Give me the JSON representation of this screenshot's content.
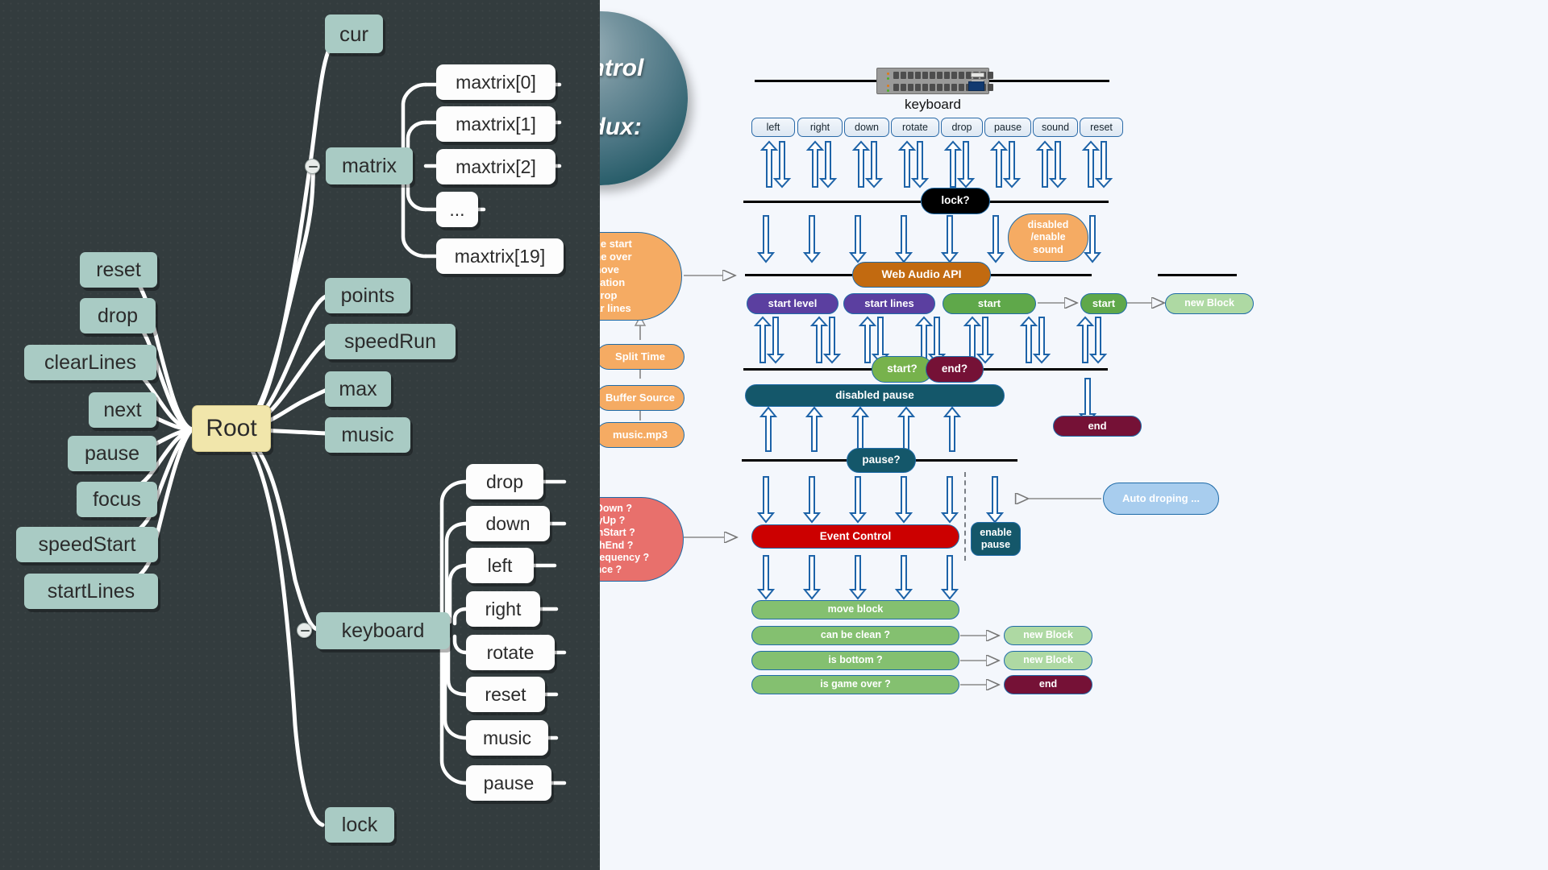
{
  "mindmap": {
    "root": {
      "label": "Root"
    },
    "nodes_left": [
      {
        "label": "reset"
      },
      {
        "label": "drop"
      },
      {
        "label": "clearLines"
      },
      {
        "label": "next"
      },
      {
        "label": "pause"
      },
      {
        "label": "focus"
      },
      {
        "label": "speedStart"
      },
      {
        "label": "startLines"
      }
    ],
    "nodes_right": [
      {
        "label": "cur"
      },
      {
        "label": "matrix"
      },
      {
        "label": "points"
      },
      {
        "label": "speedRun"
      },
      {
        "label": "max"
      },
      {
        "label": "music"
      },
      {
        "label": "keyboard"
      },
      {
        "label": "lock"
      }
    ],
    "matrix_children": [
      {
        "label": "maxtrix[0]"
      },
      {
        "label": "maxtrix[1]"
      },
      {
        "label": "maxtrix[2]"
      },
      {
        "label": "..."
      },
      {
        "label": "maxtrix[19]"
      }
    ],
    "keyboard_children": [
      {
        "label": "drop"
      },
      {
        "label": "down"
      },
      {
        "label": "left"
      },
      {
        "label": "right"
      },
      {
        "label": "rotate"
      },
      {
        "label": "reset"
      },
      {
        "label": "music"
      },
      {
        "label": "pause"
      }
    ]
  },
  "flow": {
    "title": "Control\nRedux:",
    "title_line1": "Control",
    "title_line2": "Redux:",
    "keyboard_caption": "keyboard",
    "key_buttons": [
      {
        "label": "left"
      },
      {
        "label": "right"
      },
      {
        "label": "down"
      },
      {
        "label": "rotate"
      },
      {
        "label": "drop"
      },
      {
        "label": "pause"
      },
      {
        "label": "sound"
      },
      {
        "label": "reset"
      }
    ],
    "lock": {
      "label": "lock?"
    },
    "events_oval": {
      "label": "game start\ngame over\nmove\nrotation\ndrop\nclear lines"
    },
    "split_time": {
      "label": "Split Time"
    },
    "buffer_source": {
      "label": "Buffer Source"
    },
    "music_file": {
      "label": "music.mp3"
    },
    "web_audio": {
      "label": "Web Audio API"
    },
    "disabled_enable_sound": {
      "label": "disabled\n/enable\nsound"
    },
    "start_level": {
      "label": "start level"
    },
    "start_lines": {
      "label": "start lines"
    },
    "start_green": {
      "label": "start"
    },
    "start_green2": {
      "label": "start"
    },
    "new_block_top": {
      "label": "new Block"
    },
    "start_q": {
      "label": "start?"
    },
    "end_q": {
      "label": "end?"
    },
    "disabled_pause": {
      "label": "disabled pause"
    },
    "end_node": {
      "label": "end"
    },
    "pause_q": {
      "label": "pause?"
    },
    "key_events_oval": {
      "label": "keyDown ?\nkeyUp ?\ntouchStart ?\ntouchEnd ?\nloop - frequency ?\nonce ?"
    },
    "event_control": {
      "label": "Event Control"
    },
    "enable_pause": {
      "label": "enable\npause"
    },
    "auto_droping": {
      "label": "Auto droping ..."
    },
    "bottom_rows": [
      {
        "label": "move block",
        "target": null
      },
      {
        "label": "can be clean ?",
        "target": "new Block"
      },
      {
        "label": "is bottom ?",
        "target": "new Block"
      },
      {
        "label": "is game over ?",
        "target": "end"
      }
    ]
  },
  "colors": {
    "teal_node": "#a9cbc4",
    "root_node": "#f1e6ab",
    "orange": "#f5ab63",
    "brown": "#c26a10",
    "purple": "#5b3fa0",
    "green": "#5fa84a",
    "light_green": "#aed9a3",
    "dark_teal": "#14576a",
    "red": "#cc0000",
    "maroon": "#751136",
    "blue_light": "#a8cdee",
    "arrow_blue": "#1d63a8",
    "canvas_dark": "#333c3e",
    "canvas_light": "#f4f7fc"
  }
}
